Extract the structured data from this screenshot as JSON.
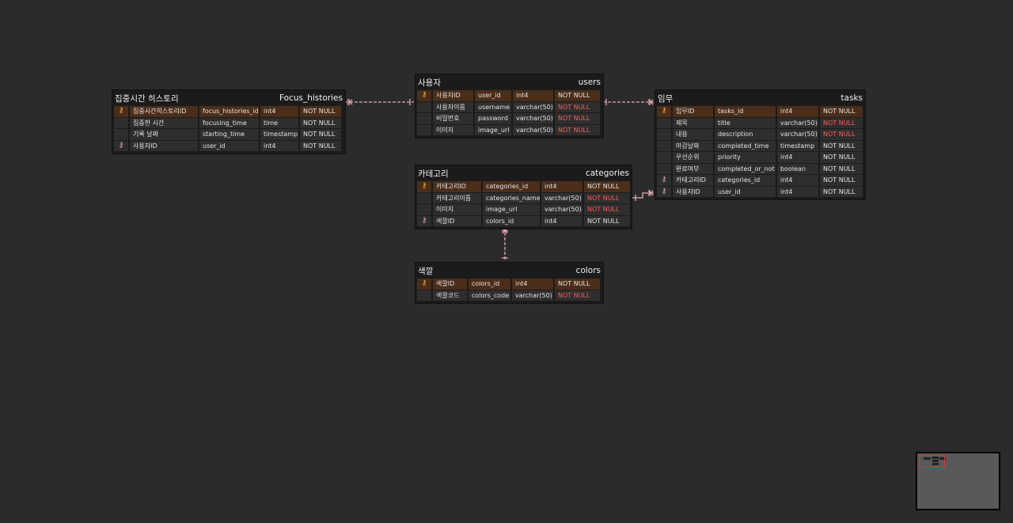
{
  "entities": [
    {
      "key": "focus",
      "title_ko": "집중시간 히스토리",
      "title_en": "Focus_histories",
      "columns": [
        {
          "key": "pk",
          "name_ko": "집중시간히스토리ID",
          "name_en": "focus_histories_id",
          "type": "int4",
          "constraint": "NOT NULL",
          "highlight": false
        },
        {
          "key": "",
          "name_ko": "집중한 시간",
          "name_en": "focusing_time",
          "type": "time",
          "constraint": "NOT NULL",
          "highlight": false
        },
        {
          "key": "",
          "name_ko": "기록 날짜",
          "name_en": "starting_time",
          "type": "timestamp",
          "constraint": "NOT NULL",
          "highlight": false
        },
        {
          "key": "fk",
          "name_ko": "사용자ID",
          "name_en": "user_id",
          "type": "int4",
          "constraint": "NOT NULL",
          "highlight": false
        }
      ]
    },
    {
      "key": "users",
      "title_ko": "사용자",
      "title_en": "users",
      "columns": [
        {
          "key": "pk",
          "name_ko": "사용자ID",
          "name_en": "user_id",
          "type": "int4",
          "constraint": "NOT NULL",
          "highlight": false
        },
        {
          "key": "",
          "name_ko": "사용자이름",
          "name_en": "username",
          "type": "varchar(50)",
          "constraint": "NOT NULL",
          "highlight": true
        },
        {
          "key": "",
          "name_ko": "비밀번호",
          "name_en": "password",
          "type": "varchar(50)",
          "constraint": "NOT NULL",
          "highlight": true
        },
        {
          "key": "",
          "name_ko": "이미지",
          "name_en": "image_url",
          "type": "varchar(50)",
          "constraint": "NOT NULL",
          "highlight": true
        }
      ]
    },
    {
      "key": "tasks",
      "title_ko": "임무",
      "title_en": "tasks",
      "columns": [
        {
          "key": "pk",
          "name_ko": "임무ID",
          "name_en": "tasks_id",
          "type": "int4",
          "constraint": "NOT NULL",
          "highlight": false
        },
        {
          "key": "",
          "name_ko": "제목",
          "name_en": "title",
          "type": "varchar(50)",
          "constraint": "NOT NULL",
          "highlight": true
        },
        {
          "key": "",
          "name_ko": "내용",
          "name_en": "description",
          "type": "varchar(50)",
          "constraint": "NOT NULL",
          "highlight": true
        },
        {
          "key": "",
          "name_ko": "마감날짜",
          "name_en": "completed_time",
          "type": "timestamp",
          "constraint": "NOT NULL",
          "highlight": false
        },
        {
          "key": "",
          "name_ko": "우선순위",
          "name_en": "priority",
          "type": "int4",
          "constraint": "NOT NULL",
          "highlight": false
        },
        {
          "key": "",
          "name_ko": "완료여부",
          "name_en": "completed_or_not",
          "type": "boolean",
          "constraint": "NOT NULL",
          "highlight": false
        },
        {
          "key": "fk",
          "name_ko": "카테고리ID",
          "name_en": "categories_id",
          "type": "int4",
          "constraint": "NOT NULL",
          "highlight": false
        },
        {
          "key": "fk",
          "name_ko": "사용자ID",
          "name_en": "user_id",
          "type": "int4",
          "constraint": "NOT NULL",
          "highlight": false
        }
      ]
    },
    {
      "key": "categories",
      "title_ko": "카테고리",
      "title_en": "categories",
      "columns": [
        {
          "key": "pk",
          "name_ko": "카테고리ID",
          "name_en": "categories_id",
          "type": "int4",
          "constraint": "NOT NULL",
          "highlight": false
        },
        {
          "key": "",
          "name_ko": "카테고리이름",
          "name_en": "categories_name",
          "type": "varchar(50)",
          "constraint": "NOT NULL",
          "highlight": true
        },
        {
          "key": "",
          "name_ko": "이미지",
          "name_en": "image_url",
          "type": "varchar(50)",
          "constraint": "NOT NULL",
          "highlight": true
        },
        {
          "key": "fk",
          "name_ko": "색깔ID",
          "name_en": "colors_id",
          "type": "int4",
          "constraint": "NOT NULL",
          "highlight": false
        }
      ]
    },
    {
      "key": "colors",
      "title_ko": "색깔",
      "title_en": "colors",
      "columns": [
        {
          "key": "pk",
          "name_ko": "색깔ID",
          "name_en": "colors_id",
          "type": "int4",
          "constraint": "NOT NULL",
          "highlight": false
        },
        {
          "key": "",
          "name_ko": "색깔코드",
          "name_en": "colors_code",
          "type": "varchar(50)",
          "constraint": "NOT NULL",
          "highlight": true
        }
      ]
    }
  ],
  "relationships": [
    {
      "from": "focus",
      "to": "users",
      "style": "dashed"
    },
    {
      "from": "users",
      "to": "tasks",
      "style": "dashed"
    },
    {
      "from": "categories",
      "to": "tasks",
      "style": "solid"
    },
    {
      "from": "categories",
      "to": "colors",
      "style": "dashed"
    }
  ],
  "colors": {
    "background": "#2b2b2b",
    "entity_bg": "#1b1b1b",
    "cell_bg": "#2e2e2e",
    "pk_row_bg": "#4b2e1a",
    "pk_icon": "#f2b62b",
    "fk_icon": "#e6a9b3",
    "relation_line": "#e8a7b2",
    "not_null_highlight": "#ff5a5a",
    "minimap_bg": "#595959",
    "minimap_viewport": "#dd3333"
  },
  "icons": {
    "pk": "key-icon",
    "fk": "foreign-key-icon"
  }
}
